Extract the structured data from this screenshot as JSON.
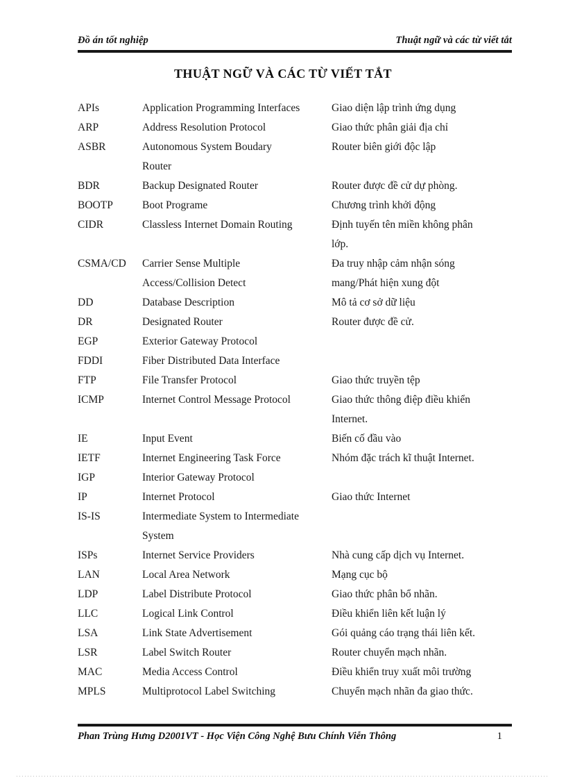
{
  "header": {
    "left": "Đồ án tốt nghiệp",
    "right": "Thuật ngữ và các từ viết tắt"
  },
  "title": "THUẬT NGỮ VÀ CÁC TỪ VIẾT TẮT",
  "columns": {
    "abbreviation": "",
    "term": "",
    "meaning": ""
  },
  "entries": [
    {
      "abbr": "APIs",
      "term": "Application Programming Interfaces",
      "term_cont": "",
      "meaning": "Giao diện lập trình ứng dụng",
      "meaning_cont": "",
      "gap_after": false
    },
    {
      "abbr": "ARP",
      "term": "Address Resolution Protocol",
      "term_cont": "",
      "meaning": "Giao thức phân giải địa chỉ",
      "meaning_cont": "",
      "gap_after": false
    },
    {
      "abbr": "ASBR",
      "term": "Autonomous System Boudary",
      "term_cont": "Router",
      "meaning": "Router biên giới độc lập",
      "meaning_cont": "",
      "gap_after": false
    },
    {
      "abbr": "BDR",
      "term": "Backup Designated Router",
      "term_cont": "",
      "meaning": "Router được đề cử dự phòng.",
      "meaning_cont": "",
      "gap_after": false
    },
    {
      "abbr": "BOOTP",
      "term": "Boot Programe",
      "term_cont": "",
      "meaning": "Chương trình khởi động",
      "meaning_cont": "",
      "gap_after": false
    },
    {
      "abbr": "CIDR",
      "term": "Classless Internet Domain Routing",
      "term_cont": "",
      "meaning": "Định tuyến tên miền không phân",
      "meaning_cont": "lớp.",
      "gap_after": false
    },
    {
      "abbr": "CSMA/CD",
      "term": "Carrier Sense Multiple",
      "term_cont": "Access/Collision Detect",
      "meaning": "Đa truy nhập cảm nhận sóng",
      "meaning_cont": "mang/Phát hiện xung đột",
      "gap_after": false
    },
    {
      "abbr": "DD",
      "term": "Database Description",
      "term_cont": "",
      "meaning": "Mô tả cơ sở dữ liệu",
      "meaning_cont": "",
      "gap_after": false
    },
    {
      "abbr": "DR",
      "term": "Designated Router",
      "term_cont": "",
      "meaning": "Router được đề cử.",
      "meaning_cont": "",
      "gap_after": false
    },
    {
      "abbr": "EGP",
      "term": "Exterior Gateway Protocol",
      "term_cont": "",
      "meaning": "",
      "meaning_cont": "",
      "gap_after": false
    },
    {
      "abbr": "FDDI",
      "term": "Fiber Distributed Data Interface",
      "term_cont": "",
      "meaning": "",
      "meaning_cont": "",
      "gap_after": false
    },
    {
      "abbr": "FTP",
      "term": "File Transfer Protocol",
      "term_cont": "",
      "meaning": "Giao thức truyền tệp",
      "meaning_cont": "",
      "gap_after": false
    },
    {
      "abbr": "ICMP",
      "term": "Internet Control Message Protocol",
      "term_cont": "",
      "meaning": "Giao thức thông điệp điều khiển",
      "meaning_cont": "Internet.",
      "gap_after": false
    },
    {
      "abbr": "IE",
      "term": "Input Event",
      "term_cont": "",
      "meaning": "Biến cố đầu vào",
      "meaning_cont": "",
      "gap_after": false
    },
    {
      "abbr": "IETF",
      "term": "Internet Engineering Task Force",
      "term_cont": "",
      "meaning": "Nhóm đặc trách kĩ thuật Internet.",
      "meaning_cont": "",
      "gap_after": false
    },
    {
      "abbr": "IGP",
      "term": "Interior Gateway Protocol",
      "term_cont": "",
      "meaning": "",
      "meaning_cont": "",
      "gap_after": false
    },
    {
      "abbr": "IP",
      "term": "Internet Protocol",
      "term_cont": "",
      "meaning": "Giao thức Internet",
      "meaning_cont": "",
      "gap_after": false
    },
    {
      "abbr": "IS-IS",
      "term": "Intermediate System to Intermediate",
      "term_cont": "System",
      "meaning": "",
      "meaning_cont": "",
      "gap_after": false
    },
    {
      "abbr": "ISPs",
      "term": "Internet Service Providers",
      "term_cont": "",
      "meaning": "Nhà cung cấp dịch vụ Internet.",
      "meaning_cont": "",
      "gap_after": false
    },
    {
      "abbr": "LAN",
      "term": "Local Area Network",
      "term_cont": "",
      "meaning": "Mạng cục bộ",
      "meaning_cont": "",
      "gap_after": false
    },
    {
      "abbr": "LDP",
      "term": "Label Distribute Protocol",
      "term_cont": "",
      "meaning": "Giao thức phân bổ nhãn.",
      "meaning_cont": "",
      "gap_after": false
    },
    {
      "abbr": "LLC",
      "term": "Logical Link Control",
      "term_cont": "",
      "meaning": "Điều khiển liên kết luận lý",
      "meaning_cont": "",
      "gap_after": false
    },
    {
      "abbr": "LSA",
      "term": "Link State Advertisement",
      "term_cont": "",
      "meaning": "Gói quảng cáo trạng thái liên kết.",
      "meaning_cont": "",
      "gap_after": false
    },
    {
      "abbr": "LSR",
      "term": "Label Switch Router",
      "term_cont": "",
      "meaning": "Router chuyển mạch nhãn.",
      "meaning_cont": "",
      "gap_after": false
    },
    {
      "abbr": "MAC",
      "term": "Media Access Control",
      "term_cont": "",
      "meaning": "Điều khiển truy xuất môi trường",
      "meaning_cont": "",
      "gap_after": false
    },
    {
      "abbr": "MPLS",
      "term": "Multiprotocol Label Switching",
      "term_cont": "",
      "meaning": "Chuyển mạch nhãn đa giao thức.",
      "meaning_cont": "",
      "gap_after": false
    }
  ],
  "footer": {
    "text": "Phan Trùng Hưng D2001VT - Học Viện Công Nghệ Bưu Chính Viễn Thông",
    "page_number": "1"
  }
}
